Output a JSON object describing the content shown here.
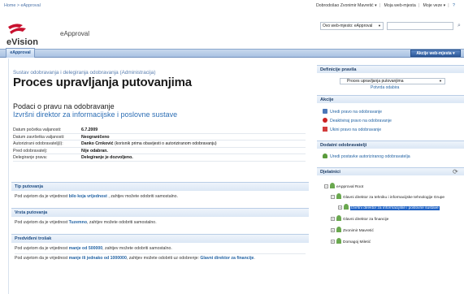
{
  "topbar": {
    "breadcrumb": "Home > eApproval",
    "welcome": "Dobrodošao Zvonimir Mavretić ▾",
    "my_site": "Moja web-mjesta",
    "my_links": "Moje veze ▾"
  },
  "brand": {
    "logo_text": "eVision",
    "app_name": "eApproval"
  },
  "search": {
    "scope": "Ovo web-mjesto: eApproval",
    "value": ""
  },
  "nav": {
    "active_tab": "eApproval",
    "site_actions": "Akcije web-mjesta ▾"
  },
  "page": {
    "breadcrumb": "Sustav odobravanja i delegiranja odobravanja (Administracija)",
    "title": "Proces upravljanja putovanjima",
    "section_title": "Podaci o pravu na odobravanje",
    "role_title": "Izvršni direktor za informacijske i poslovne sustave",
    "properties": [
      {
        "key": "Datum početka valjanosti:",
        "value": "6.7.2009",
        "note": ""
      },
      {
        "key": "Datum završetka valjanosti:",
        "value": "Neograničeno",
        "note": ""
      },
      {
        "key": "Autorizirani odobravatelj(i):",
        "value": "Danko Crnković",
        "note": " (korisnik prima obavijesti o autoriziranom odobravanju)"
      },
      {
        "key": "Pred odobravatelj:",
        "value": "Nije odabran.",
        "note": ""
      },
      {
        "key": "Delegiranje prava:",
        "value": "Delegiranje je dozvoljeno.",
        "note": ""
      }
    ],
    "sections": [
      {
        "title": "Tip putovanja",
        "pre": "Pod uvjetom da je vrijednost ",
        "highlight": "bilo koja vrijednost",
        "post": " , zahtjev možete odobriti samostalno.",
        "highlight2": "",
        "post2": ""
      },
      {
        "title": "Vrsta putovanja",
        "pre": "Pod uvjetom da je vrijednost ",
        "highlight": "Tuzemno",
        "post": ", zahtjev možete odobriti samostalno.",
        "highlight2": "",
        "post2": ""
      },
      {
        "title": "Predviđeni trošak",
        "pre": "Pod uvjetom da je vrijednost ",
        "highlight": "manje od 500000",
        "post": ", zahtjev možete odobriti samostalno.",
        "highlight2": "",
        "post2": ""
      }
    ],
    "extra_line": {
      "pre": "Pod uvjetom da je vrijednost ",
      "highlight": "manje ili jednako od 1000000",
      "post": ", zahtjev možete odobriti uz odobrenje: ",
      "highlight2": "Glavni direktor za financije",
      "post2": "."
    }
  },
  "sidebar": {
    "rules_title": "Definicije pravila",
    "rules_selected": "Proces upravljanja putovanjima",
    "rules_confirm": "Potvrda odabira",
    "actions_title": "Akcije",
    "actions": [
      {
        "label": "Uredi pravo na odobravanje",
        "icon": "edit-icon",
        "color": "#4b77b8"
      },
      {
        "label": "Deaktiviraj pravo na odobravanje",
        "icon": "deactivate-icon",
        "color": "#cc2222"
      },
      {
        "label": "Ukini pravo na odobravanje",
        "icon": "delete-icon",
        "color": "#d23c3c"
      }
    ],
    "extra_title": "Dodatni odobravatelji",
    "extra_action": "Uredi postavke autoriziranog odobravatelja",
    "tree_title": "Djelatnici",
    "tree": [
      {
        "label": "eApproval Root",
        "expander": "−",
        "selected": false
      },
      {
        "label": "Glavni direktor za tehniku i informacijske tehnologije Grupe",
        "expander": "−",
        "selected": false
      },
      {
        "label": "Izvršni direktor za informacijske i poslovne sustave",
        "expander": "+",
        "selected": true
      },
      {
        "label": "Glavni direktor za financije",
        "expander": "+",
        "selected": false
      },
      {
        "label": "Zvonimir Mavretić",
        "expander": "+",
        "selected": false
      },
      {
        "label": "Domagoj Miletić",
        "expander": "+",
        "selected": false
      }
    ]
  }
}
